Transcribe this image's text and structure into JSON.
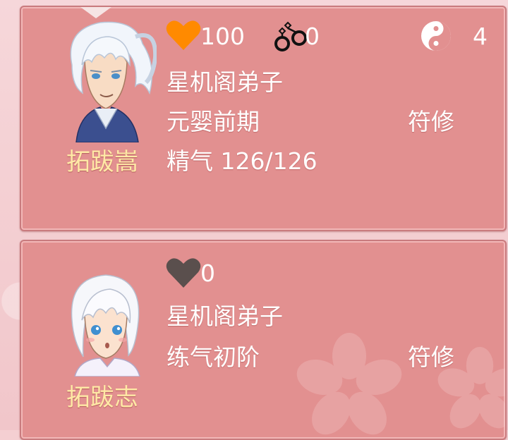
{
  "cards": [
    {
      "name": "拓跋嵩",
      "favor": "100",
      "favor_color": "#ff8a00",
      "captured": "0",
      "yinyang": "4",
      "faction": "星机阁弟子",
      "realm": "元婴前期",
      "path": "符修",
      "energy": "精气 126/126",
      "icons": [
        "heart-icon",
        "handcuffs-icon",
        "yin-yang-icon"
      ]
    },
    {
      "name": "拓跋志",
      "favor": "0",
      "favor_color": "#5a4f4d",
      "faction": "星机阁弟子",
      "realm": "练气初阶",
      "path": "符修",
      "icons": [
        "heart-icon"
      ]
    }
  ]
}
